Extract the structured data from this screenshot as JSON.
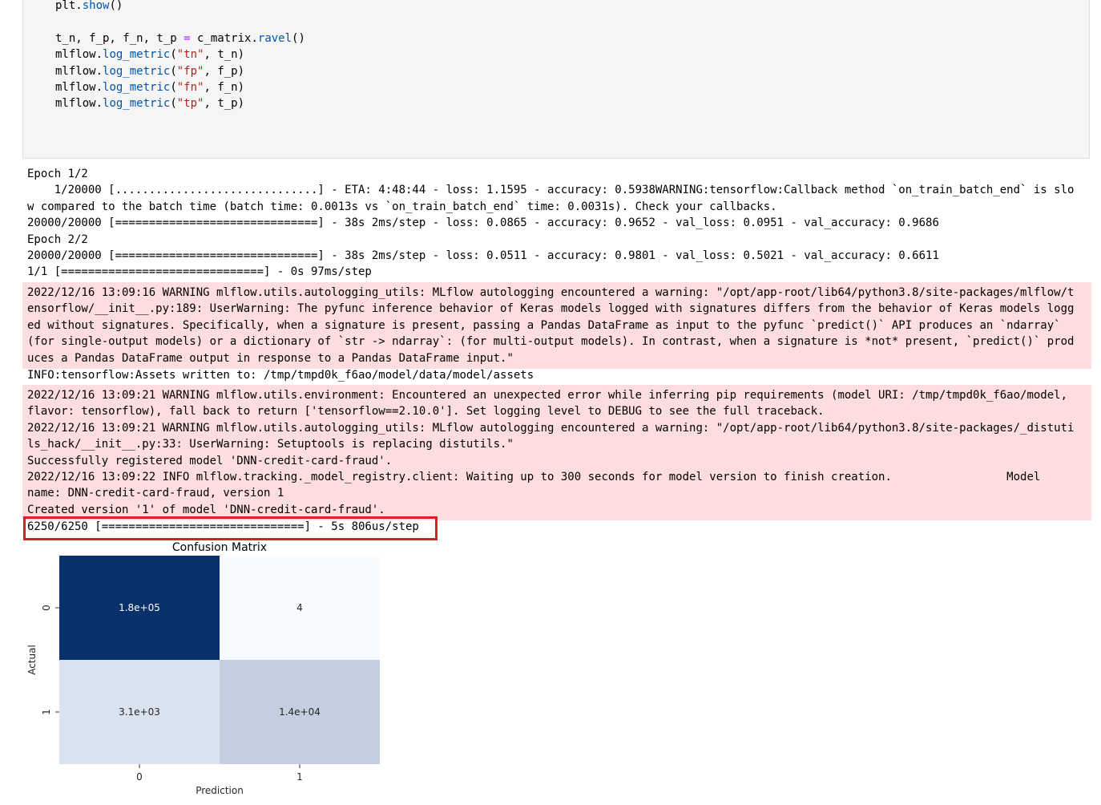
{
  "code_cell": {
    "lines": [
      "plt.show()",
      "t_n, f_p, f_n, t_p = c_matrix.ravel()",
      "mlflow.log_metric(\"tn\", t_n)",
      "mlflow.log_metric(\"fp\", f_p)",
      "mlflow.log_metric(\"fn\", f_n)",
      "mlflow.log_metric(\"tp\", t_p)"
    ]
  },
  "stdout_block_1": {
    "lines": [
      "Epoch 1/2",
      "    1/20000 [..............................] - ETA: 4:48:44 - loss: 1.1595 - accuracy: 0.5938WARNING:tensorflow:Callback method `on_train_batch_end` is slo",
      "w compared to the batch time (batch time: 0.0013s vs `on_train_batch_end` time: 0.0031s). Check your callbacks.",
      "20000/20000 [==============================] - 38s 2ms/step - loss: 0.0865 - accuracy: 0.9652 - val_loss: 0.0951 - val_accuracy: 0.9686",
      "Epoch 2/2",
      "20000/20000 [==============================] - 38s 2ms/step - loss: 0.0511 - accuracy: 0.9801 - val_loss: 0.5021 - val_accuracy: 0.6611",
      "1/1 [==============================] - 0s 97ms/step"
    ]
  },
  "stderr_block_1": {
    "lines": [
      "2022/12/16 13:09:16 WARNING mlflow.utils.autologging_utils: MLflow autologging encountered a warning: \"/opt/app-root/lib64/python3.8/site-packages/mlflow/t",
      "ensorflow/__init__.py:189: UserWarning: The pyfunc inference behavior of Keras models logged with signatures differs from the behavior of Keras models logg",
      "ed without signatures. Specifically, when a signature is present, passing a Pandas DataFrame as input to the pyfunc `predict()` API produces an `ndarray`",
      "(for single-output models) or a dictionary of `str -> ndarray`: (for multi-output models). In contrast, when a signature is *not* present, `predict()` prod",
      "uces a Pandas DataFrame output in response to a Pandas DataFrame input.\""
    ]
  },
  "stdout_block_2": {
    "lines": [
      "INFO:tensorflow:Assets written to: /tmp/tmpd0k_f6ao/model/data/model/assets"
    ]
  },
  "stderr_block_2": {
    "lines": [
      "2022/12/16 13:09:21 WARNING mlflow.utils.environment: Encountered an unexpected error while inferring pip requirements (model URI: /tmp/tmpd0k_f6ao/model,",
      "flavor: tensorflow), fall back to return ['tensorflow==2.10.0']. Set logging level to DEBUG to see the full traceback.",
      "2022/12/16 13:09:21 WARNING mlflow.utils.autologging_utils: MLflow autologging encountered a warning: \"/opt/app-root/lib64/python3.8/site-packages/_distuti",
      "ls_hack/__init__.py:33: UserWarning: Setuptools is replacing distutils.\"",
      "Successfully registered model 'DNN-credit-card-fraud'.",
      "2022/12/16 13:09:22 INFO mlflow.tracking._model_registry.client: Waiting up to 300 seconds for model version to finish creation.                 Model",
      "name: DNN-credit-card-fraud, version 1",
      "Created version '1' of model 'DNN-credit-card-fraud'."
    ]
  },
  "stdout_block_3": {
    "lines": [
      "6250/6250 [==============================] - 5s 806us/step"
    ]
  },
  "highlight": {
    "color": "#e01b24"
  },
  "chart_data": {
    "type": "heatmap",
    "title": "Confusion Matrix",
    "xlabel": "Prediction",
    "ylabel": "Actual",
    "x_categories": [
      "0",
      "1"
    ],
    "y_categories": [
      "0",
      "1"
    ],
    "values": [
      [
        180000,
        4
      ],
      [
        3100,
        14000
      ]
    ],
    "annotations": [
      [
        "1.8e+05",
        "4"
      ],
      [
        "3.1e+03",
        "1.4e+04"
      ]
    ],
    "colormap": "Blues",
    "colorbar": false
  },
  "colors": {
    "code_background": "#f5f5f5",
    "stderr_background": "#fddddd",
    "keyword_purple": "#aa22ff",
    "attr_blue": "#0055aa",
    "string_red": "#ba2121"
  }
}
